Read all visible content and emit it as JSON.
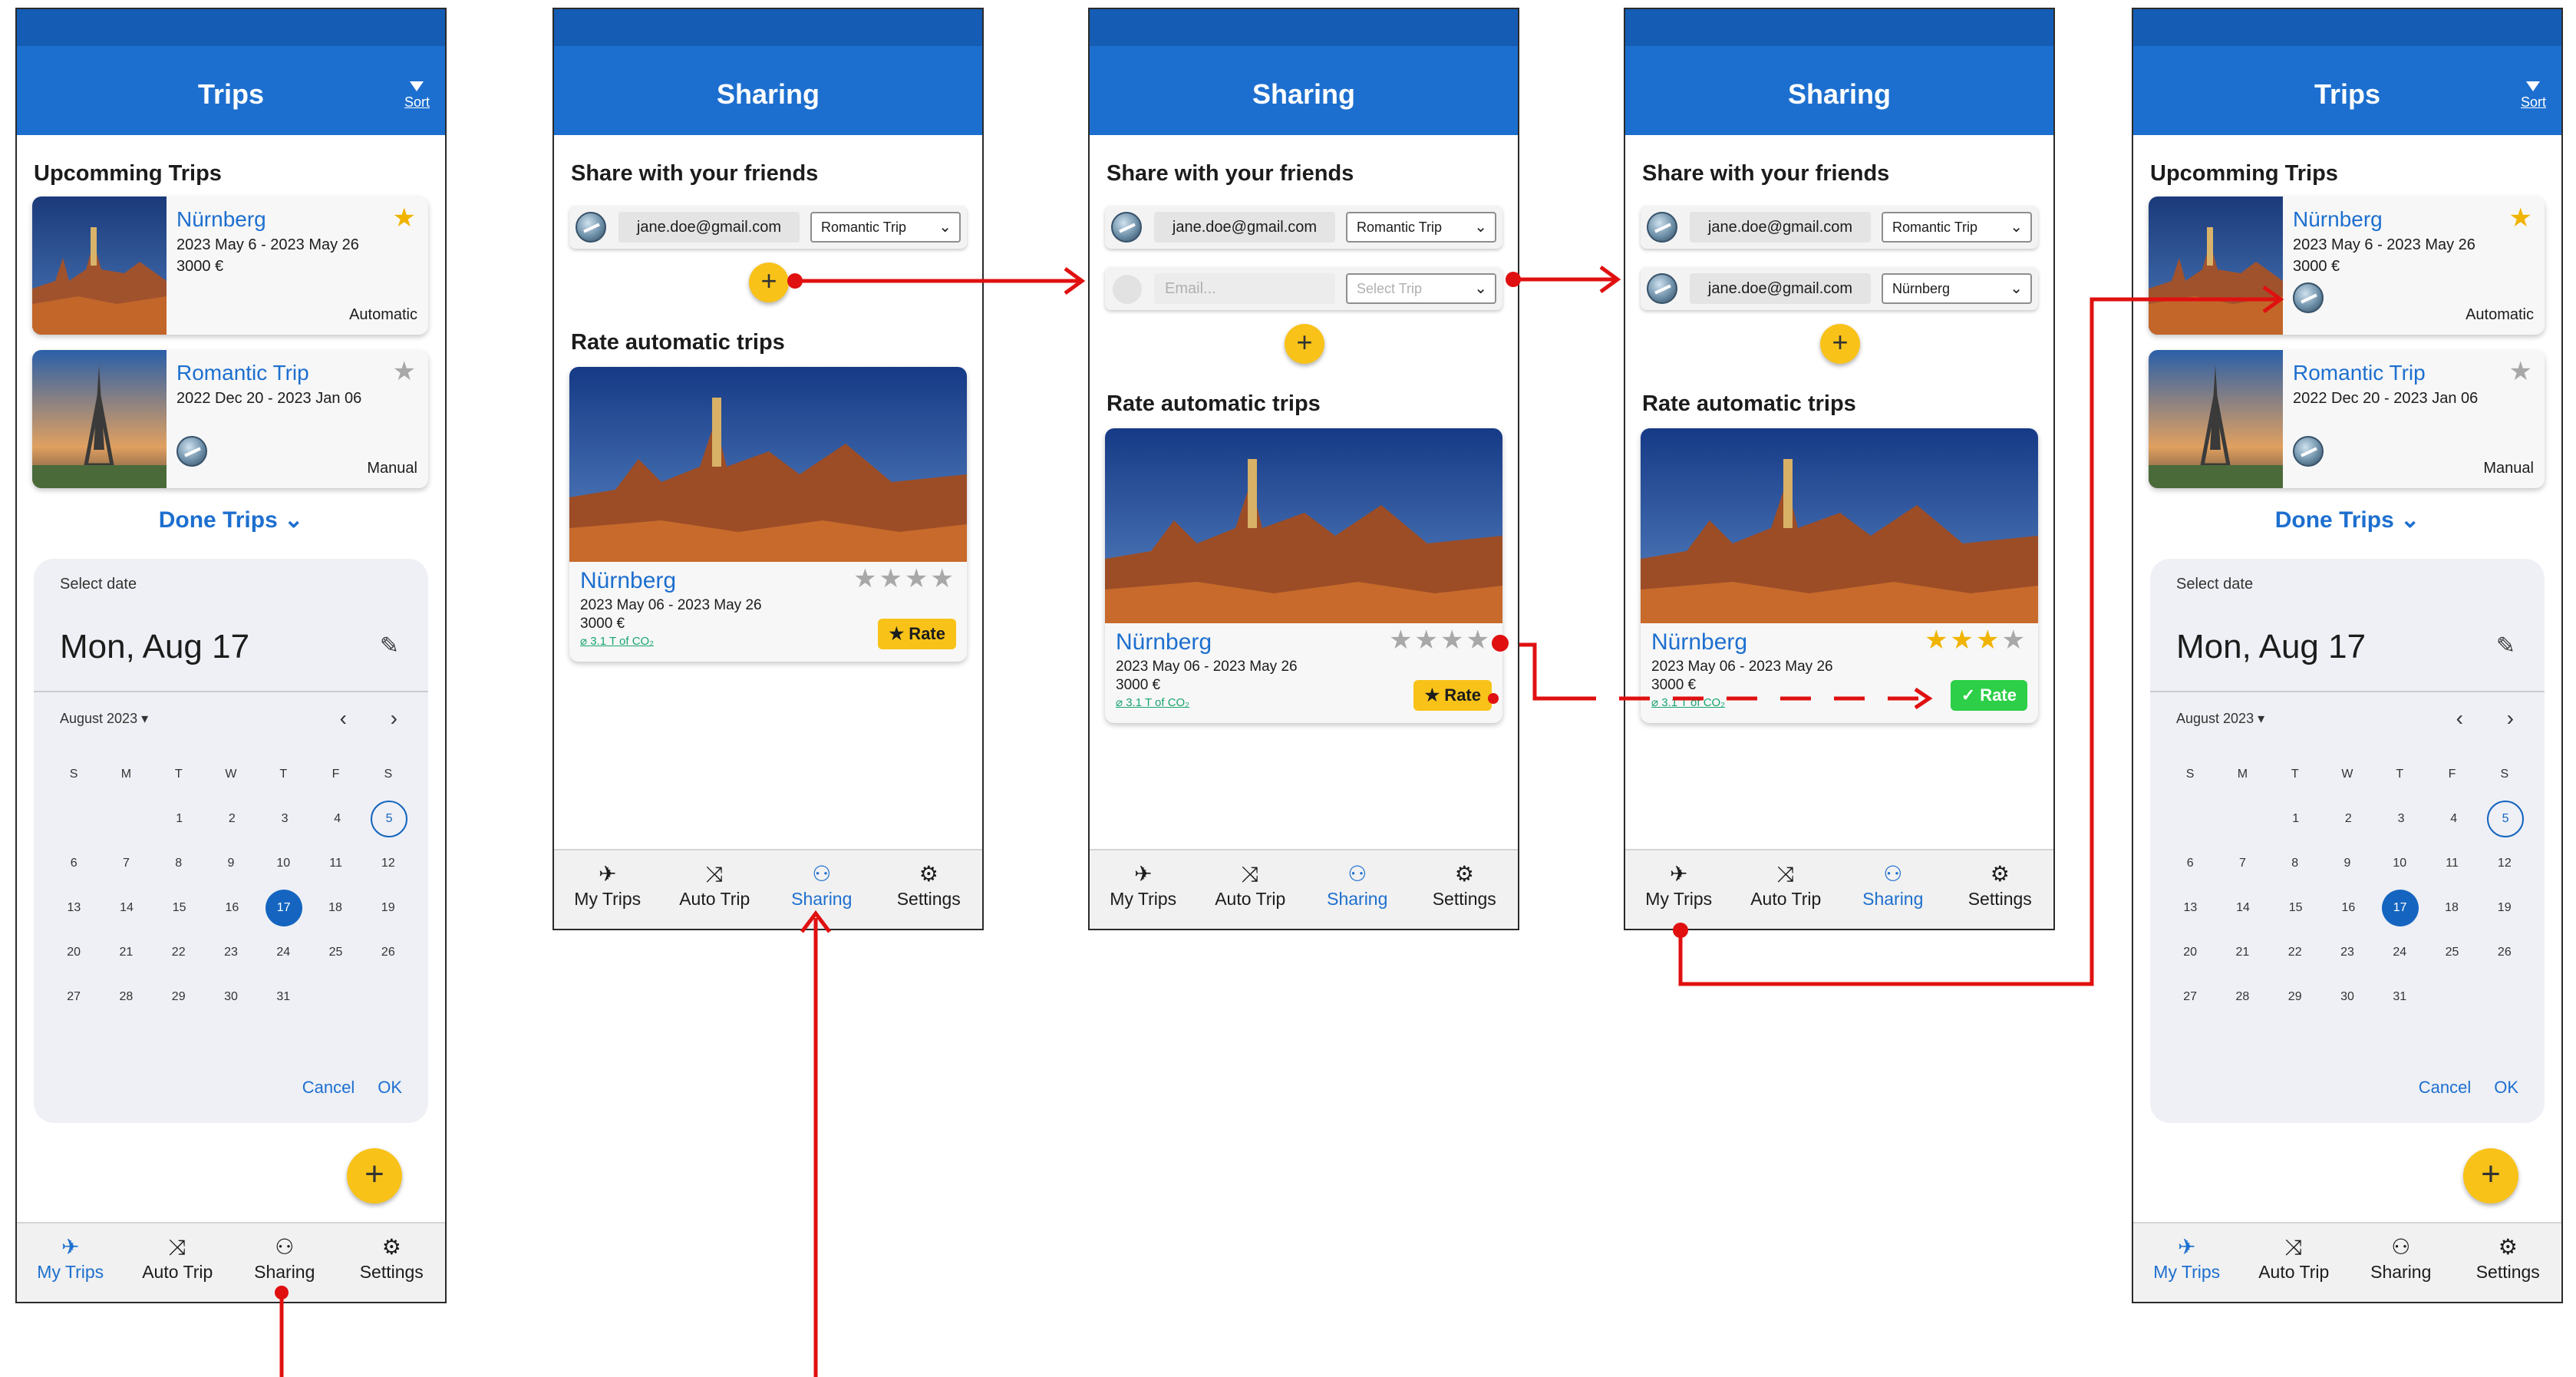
{
  "nav": {
    "my_trips": "My Trips",
    "auto_trip": "Auto Trip",
    "sharing": "Sharing",
    "settings": "Settings"
  },
  "trips": {
    "title": "Trips",
    "sort_label": "Sort",
    "upcoming_heading": "Upcomming Trips",
    "done_trips": "Done Trips",
    "cards": [
      {
        "name": "Nürnberg",
        "dates": "2023 May 6 - 2023 May 26",
        "price": "3000 €",
        "mode": "Automatic",
        "starred": true
      },
      {
        "name": "Romantic Trip",
        "dates": "2022 Dec 20 - 2023 Jan 06",
        "price": "",
        "mode": "Manual",
        "starred": false
      }
    ],
    "date_picker": {
      "select_label": "Select date",
      "selected": "Mon, Aug 17",
      "month": "August 2023",
      "weekdays": [
        "S",
        "M",
        "T",
        "W",
        "T",
        "F",
        "S"
      ],
      "weeks": [
        [
          "",
          "",
          "1",
          "2",
          "3",
          "4",
          "5"
        ],
        [
          "6",
          "7",
          "8",
          "9",
          "10",
          "11",
          "12"
        ],
        [
          "13",
          "14",
          "15",
          "16",
          "17",
          "18",
          "19"
        ],
        [
          "20",
          "21",
          "22",
          "23",
          "24",
          "25",
          "26"
        ],
        [
          "27",
          "28",
          "29",
          "30",
          "31",
          "",
          ""
        ]
      ],
      "today": "17",
      "ringed": "5",
      "cancel": "Cancel",
      "ok": "OK"
    }
  },
  "sharing": {
    "title": "Sharing",
    "share_heading": "Share with your friends",
    "rate_heading": "Rate automatic trips",
    "email": "jane.doe@gmail.com",
    "email_placeholder": "Email...",
    "trip_romantic": "Romantic Trip",
    "trip_placeholder": "Select Trip",
    "trip_nurnberg": "Nürnberg",
    "rate_card": {
      "name": "Nürnberg",
      "dates": "2023 May 06 - 2023 May 26",
      "price": "3000 €",
      "co2": "3.1 T of CO₂",
      "rate_label": "★ Rate",
      "rated_label": "✓ Rate"
    }
  },
  "icons": {
    "plane": "plane-icon",
    "shuffle": "shuffle-icon",
    "people": "people-icon",
    "gear": "gear-icon",
    "plus": "plus-icon",
    "star": "star-icon",
    "pencil": "pencil-icon",
    "chevron": "chevron-down-icon",
    "leaf": "leaf-icon"
  },
  "colors": {
    "primary": "#1d6fcf",
    "accent_yellow": "#f8c219",
    "star_gold": "#f0b400",
    "success_green": "#2ccf47",
    "arrow_red": "#e01010"
  }
}
